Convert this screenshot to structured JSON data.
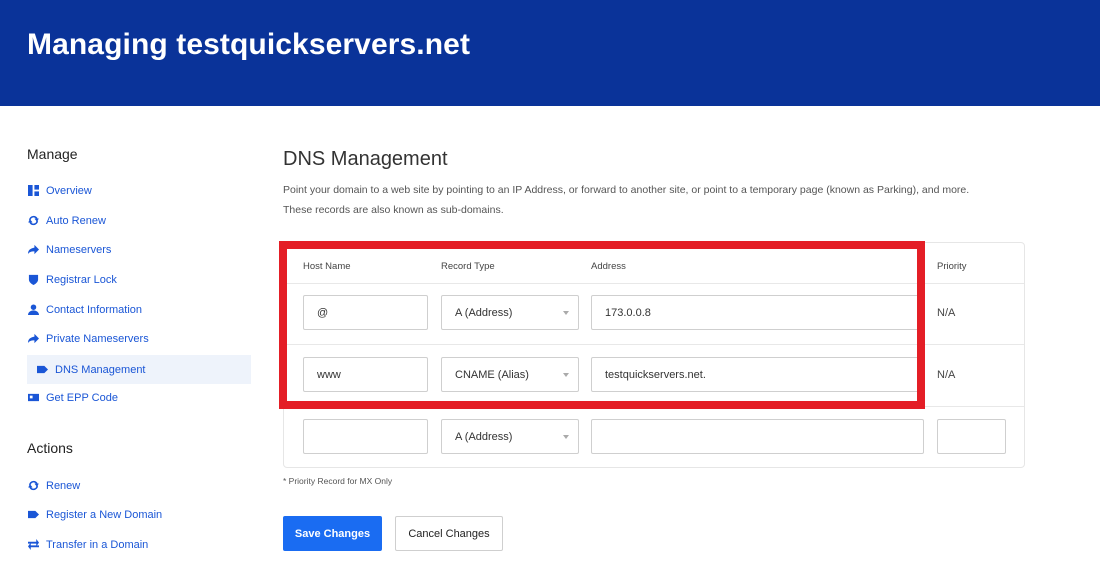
{
  "header": {
    "title": "Managing testquickservers.net"
  },
  "sidebar": {
    "manage_title": "Manage",
    "manage_items": [
      {
        "label": "Overview",
        "icon": "dashboard-icon"
      },
      {
        "label": "Auto Renew",
        "icon": "refresh-icon"
      },
      {
        "label": "Nameservers",
        "icon": "arrow-right-icon"
      },
      {
        "label": "Registrar Lock",
        "icon": "shield-icon"
      },
      {
        "label": "Contact Information",
        "icon": "user-icon"
      },
      {
        "label": "Private Nameservers",
        "icon": "arrow-right-icon"
      },
      {
        "label": "DNS Management",
        "icon": "tag-icon",
        "active": true
      },
      {
        "label": "Get EPP Code",
        "icon": "id-card-icon"
      }
    ],
    "actions_title": "Actions",
    "action_items": [
      {
        "label": "Renew",
        "icon": "refresh-icon"
      },
      {
        "label": "Register a New Domain",
        "icon": "tag-icon"
      },
      {
        "label": "Transfer in a Domain",
        "icon": "exchange-icon"
      }
    ]
  },
  "main": {
    "title": "DNS Management",
    "description_line1": "Point your domain to a web site by pointing to an IP Address, or forward to another site, or point to a temporary page (known as Parking), and more.",
    "description_line2": "These records are also known as sub-domains.",
    "table": {
      "headers": {
        "host": "Host Name",
        "type": "Record Type",
        "address": "Address",
        "priority": "Priority"
      },
      "rows": [
        {
          "host": "@",
          "type": "A (Address)",
          "address": "173.0.0.8",
          "priority": "N/A"
        },
        {
          "host": "www",
          "type": "CNAME (Alias)",
          "address": "testquickservers.net.",
          "priority": "N/A"
        },
        {
          "host": "",
          "type": "A (Address)",
          "address": "",
          "priority": ""
        }
      ]
    },
    "note": "* Priority Record for MX Only",
    "save_label": "Save Changes",
    "cancel_label": "Cancel Changes"
  },
  "colors": {
    "header_bg": "#0a3399",
    "link": "#1a56d6",
    "primary_button": "#1a6cf2",
    "highlight": "#e41e26"
  }
}
